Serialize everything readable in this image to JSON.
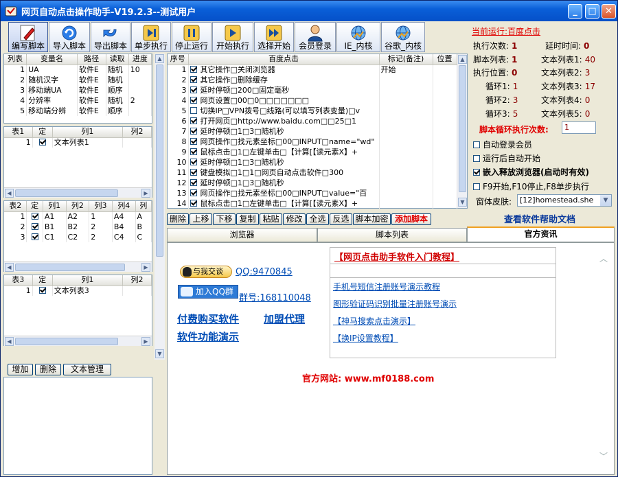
{
  "window": {
    "title": "网页自动点击操作助手-V19.2.3--测试用户"
  },
  "toolbar": [
    {
      "name": "edit-script-button",
      "label": "编写脚本",
      "icon": "pencil-icon"
    },
    {
      "name": "import-script-button",
      "label": "导入脚本",
      "icon": "refresh-icon"
    },
    {
      "name": "export-script-button",
      "label": "导出脚本",
      "icon": "undo-arrow-icon"
    },
    {
      "name": "step-run-button",
      "label": "单步执行",
      "icon": "step-forward-icon"
    },
    {
      "name": "stop-run-button",
      "label": "停止运行",
      "icon": "pause-icon"
    },
    {
      "name": "start-run-button",
      "label": "开始执行",
      "icon": "play-icon"
    },
    {
      "name": "select-start-button",
      "label": "选择开始",
      "icon": "fast-forward-icon"
    },
    {
      "name": "member-login-button",
      "label": "会员登录",
      "icon": "user-icon"
    },
    {
      "name": "ie-kernel-button",
      "label": "IE_内核",
      "icon": "globe-icon"
    },
    {
      "name": "chrome-kernel-button",
      "label": "谷歌_内核",
      "icon": "globe-icon"
    }
  ],
  "var_table": {
    "headers": [
      "列表",
      "变量名",
      "路径",
      "读取",
      "进度"
    ],
    "rows": [
      [
        "1",
        "UA",
        "软件E",
        "随机",
        "10"
      ],
      [
        "2",
        "随机汉字",
        "软件E",
        "随机",
        ""
      ],
      [
        "3",
        "移动端UA",
        "软件E",
        "顺序",
        ""
      ],
      [
        "4",
        "分辨率",
        "软件E",
        "随机",
        "2"
      ],
      [
        "5",
        "移动端分辨",
        "软件E",
        "顺序",
        ""
      ]
    ]
  },
  "table1": {
    "headers": [
      "表1",
      "定",
      "列1",
      "列2"
    ],
    "rows": [
      [
        "1",
        true,
        "文本列表1",
        ""
      ]
    ]
  },
  "table2": {
    "headers": [
      "表2",
      "定",
      "列1",
      "列2",
      "列3",
      "列4",
      "列"
    ],
    "rows": [
      [
        "1",
        true,
        "A1",
        "A2",
        "1",
        "A4",
        "A"
      ],
      [
        "2",
        true,
        "B1",
        "B2",
        "2",
        "B4",
        "B"
      ],
      [
        "3",
        true,
        "C1",
        "C2",
        "2",
        "C4",
        "C"
      ]
    ]
  },
  "table3": {
    "headers": [
      "表3",
      "定",
      "列1",
      "列2"
    ],
    "rows": [
      [
        "1",
        true,
        "文本列表3",
        ""
      ]
    ]
  },
  "bottom_left_buttons": [
    "增加",
    "删除",
    "文本管理"
  ],
  "script_table": {
    "headers": [
      "序号",
      "百度点击",
      "标记(备注)",
      "位置"
    ],
    "rows": [
      [
        "1",
        true,
        "其它操作□关闭浏览器",
        "开始"
      ],
      [
        "2",
        true,
        "其它操作□删除缓存",
        ""
      ],
      [
        "3",
        true,
        "延时停顿□200□固定毫秒",
        ""
      ],
      [
        "4",
        true,
        "网页设置□00□0□□□□□□□",
        ""
      ],
      [
        "5",
        false,
        "切换IP□VPN拨号□线路(可以填写列表变量)□v",
        ""
      ],
      [
        "6",
        true,
        "打开网页□http://www.baidu.com□□25□1",
        ""
      ],
      [
        "7",
        true,
        "延时停顿□1□3□随机秒",
        ""
      ],
      [
        "8",
        true,
        "网页操作□找元素坐标□00□INPUT□name=\"wd\"",
        ""
      ],
      [
        "9",
        true,
        "鼠标点击□1□左键单击□【计算[【读元素X】+",
        ""
      ],
      [
        "10",
        true,
        "延时停顿□1□3□随机秒",
        ""
      ],
      [
        "11",
        true,
        "键盘模拟□1□1□网页自动点击软件□300",
        ""
      ],
      [
        "12",
        true,
        "延时停顿□1□3□随机秒",
        ""
      ],
      [
        "13",
        true,
        "网页操作□找元素坐标□00□INPUT□value=\"百",
        ""
      ],
      [
        "14",
        true,
        "鼠标点击□1□左键单击□【计算[【读元素X】+",
        ""
      ]
    ]
  },
  "script_buttons": [
    "删除",
    "上移",
    "下移",
    "复制",
    "粘贴",
    "修改",
    "全选",
    "反选",
    "脚本加密",
    "添加脚本"
  ],
  "tabs": [
    "浏览器",
    "脚本列表",
    "官方资讯"
  ],
  "status": {
    "current_label": "当前运行:",
    "current_value": "百度点击",
    "exec_count_label": "执行次数:",
    "exec_count": "1",
    "delay_label": "延时时间:",
    "delay": "0",
    "script_list_label": "脚本列表:",
    "script_list": "1",
    "text_list1_label": "文本列表1:",
    "text_list1": "40",
    "exec_pos_label": "执行位置:",
    "exec_pos": "0",
    "text_list2_label": "文本列表2:",
    "text_list2": "3",
    "loop1_label": "循环1:",
    "loop1": "1",
    "text_list3_label": "文本列表3:",
    "text_list3": "17",
    "loop2_label": "循环2:",
    "loop2": "3",
    "text_list4_label": "文本列表4:",
    "text_list4": "0",
    "loop3_label": "循环3:",
    "loop3": "5",
    "text_list5_label": "文本列表5:",
    "text_list5": "0",
    "loop_count_label": "脚本循环执行次数:",
    "loop_count_value": "1"
  },
  "options": [
    {
      "name": "auto-login-checkbox",
      "label": "自动登录会员",
      "checked": false,
      "bold": false
    },
    {
      "name": "auto-start-checkbox",
      "label": "运行后自动开始",
      "checked": false,
      "bold": false
    },
    {
      "name": "embed-browser-checkbox",
      "label": "嵌入释放浏览器(启动时有效)",
      "checked": true,
      "bold": true
    },
    {
      "name": "hotkey-checkbox",
      "label": "F9开始,F10停止,F8单步执行",
      "checked": false,
      "bold": false
    }
  ],
  "skin": {
    "label": "窗体皮肤:",
    "value": "[12]homestead.she"
  },
  "help_link": "查看软件帮助文档",
  "news": {
    "qq_chat": "与我交谈",
    "qq": "QQ:9470845",
    "qq_group_btn": "加入QQ群",
    "group": "群号:168110048",
    "buy": "付费购买软件",
    "agent": "加盟代理",
    "demo": "软件功能演示",
    "tutorial_title": "【网页点击助手软件入门教程】",
    "tutorials": [
      "手机号短信注册账号演示教程",
      "图形验证码识别批量注册账号演示",
      "【神马搜索点击演示】",
      "【换IP设置教程】"
    ],
    "website": "官方网站: www.mf0188.com"
  },
  "colors": {
    "title_bar": "#0a5fd8",
    "accent_red": "#e00000",
    "link_blue": "#004cb5",
    "window_bg": "#ece9d8"
  }
}
